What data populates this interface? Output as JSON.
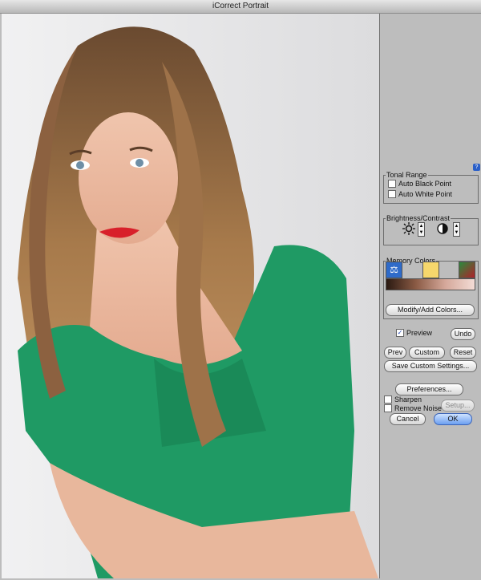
{
  "window": {
    "title": "iCorrect Portrait"
  },
  "tonal_range": {
    "legend": "Tonal Range",
    "auto_black_label": "Auto Black Point",
    "auto_black_checked": false,
    "auto_white_label": "Auto White Point",
    "auto_white_checked": false
  },
  "brightness_contrast": {
    "legend": "Brightness/Contrast",
    "brightness_icon": "sun-icon",
    "contrast_icon": "contrast-icon"
  },
  "memory_colors": {
    "legend": "Memory Colors",
    "modify_label": "Modify/Add Colors..."
  },
  "preview": {
    "label": "Preview",
    "checked": true
  },
  "buttons": {
    "undo": "Undo",
    "prev": "Prev",
    "custom": "Custom",
    "reset": "Reset",
    "save_custom": "Save Custom Settings...",
    "preferences": "Preferences...",
    "setup": "Setup...",
    "cancel": "Cancel",
    "ok": "OK"
  },
  "sharpen": {
    "label": "Sharpen",
    "checked": false
  },
  "remove_noise": {
    "label": "Remove Noise",
    "checked": false
  },
  "colors": {
    "panel": "#bdbdbd",
    "accent": "#6b9ff0",
    "shirt": "#1f9a64"
  }
}
